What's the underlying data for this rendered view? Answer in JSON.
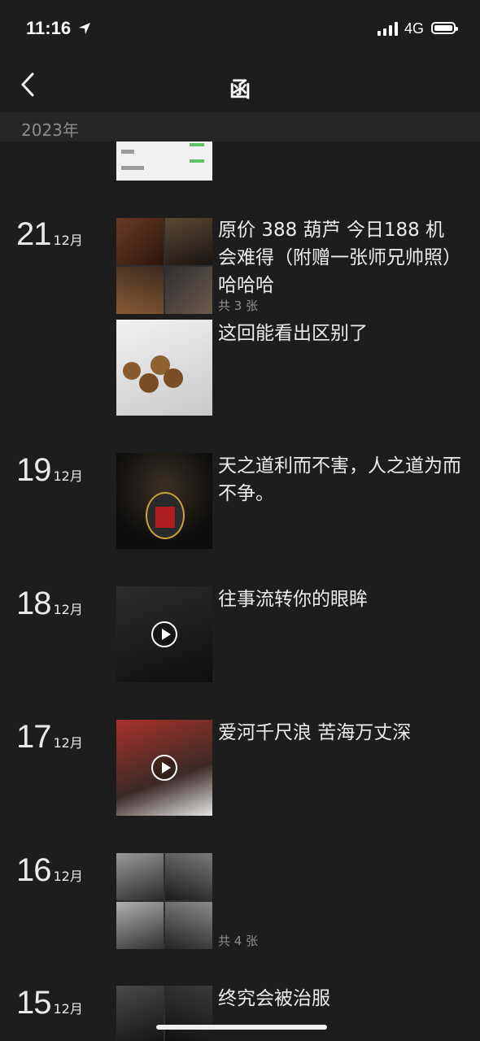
{
  "status_bar": {
    "time": "11:16",
    "network": "4G"
  },
  "nav": {
    "title": "函"
  },
  "year_header": "2023年",
  "posts": [
    {
      "day": "21",
      "month": "12月",
      "text": "原价 388 葫芦  今日188 机会难得（附赠一张师兄帅照）哈哈哈",
      "count": "共 3 张"
    },
    {
      "text": "这回能看出区别了"
    },
    {
      "day": "19",
      "month": "12月",
      "text": "天之道利而不害，人之道为而不争。"
    },
    {
      "day": "18",
      "month": "12月",
      "text": "往事流转你的眼眸"
    },
    {
      "day": "17",
      "month": "12月",
      "text": "爱河千尺浪 苦海万丈深"
    },
    {
      "day": "16",
      "month": "12月",
      "count": "共 4 张"
    },
    {
      "day": "15",
      "month": "12月",
      "text": "终究会被治服"
    }
  ]
}
